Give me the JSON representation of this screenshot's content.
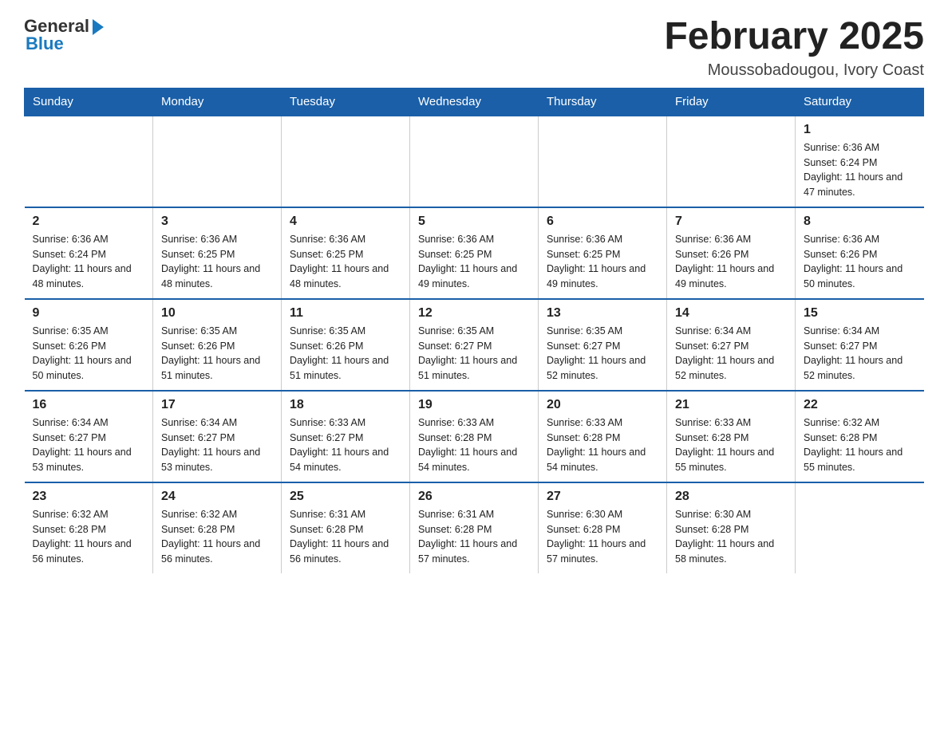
{
  "logo": {
    "general": "General",
    "blue": "Blue"
  },
  "title": "February 2025",
  "location": "Moussobadougou, Ivory Coast",
  "days_of_week": [
    "Sunday",
    "Monday",
    "Tuesday",
    "Wednesday",
    "Thursday",
    "Friday",
    "Saturday"
  ],
  "weeks": [
    [
      {
        "day": "",
        "info": ""
      },
      {
        "day": "",
        "info": ""
      },
      {
        "day": "",
        "info": ""
      },
      {
        "day": "",
        "info": ""
      },
      {
        "day": "",
        "info": ""
      },
      {
        "day": "",
        "info": ""
      },
      {
        "day": "1",
        "info": "Sunrise: 6:36 AM\nSunset: 6:24 PM\nDaylight: 11 hours and 47 minutes."
      }
    ],
    [
      {
        "day": "2",
        "info": "Sunrise: 6:36 AM\nSunset: 6:24 PM\nDaylight: 11 hours and 48 minutes."
      },
      {
        "day": "3",
        "info": "Sunrise: 6:36 AM\nSunset: 6:25 PM\nDaylight: 11 hours and 48 minutes."
      },
      {
        "day": "4",
        "info": "Sunrise: 6:36 AM\nSunset: 6:25 PM\nDaylight: 11 hours and 48 minutes."
      },
      {
        "day": "5",
        "info": "Sunrise: 6:36 AM\nSunset: 6:25 PM\nDaylight: 11 hours and 49 minutes."
      },
      {
        "day": "6",
        "info": "Sunrise: 6:36 AM\nSunset: 6:25 PM\nDaylight: 11 hours and 49 minutes."
      },
      {
        "day": "7",
        "info": "Sunrise: 6:36 AM\nSunset: 6:26 PM\nDaylight: 11 hours and 49 minutes."
      },
      {
        "day": "8",
        "info": "Sunrise: 6:36 AM\nSunset: 6:26 PM\nDaylight: 11 hours and 50 minutes."
      }
    ],
    [
      {
        "day": "9",
        "info": "Sunrise: 6:35 AM\nSunset: 6:26 PM\nDaylight: 11 hours and 50 minutes."
      },
      {
        "day": "10",
        "info": "Sunrise: 6:35 AM\nSunset: 6:26 PM\nDaylight: 11 hours and 51 minutes."
      },
      {
        "day": "11",
        "info": "Sunrise: 6:35 AM\nSunset: 6:26 PM\nDaylight: 11 hours and 51 minutes."
      },
      {
        "day": "12",
        "info": "Sunrise: 6:35 AM\nSunset: 6:27 PM\nDaylight: 11 hours and 51 minutes."
      },
      {
        "day": "13",
        "info": "Sunrise: 6:35 AM\nSunset: 6:27 PM\nDaylight: 11 hours and 52 minutes."
      },
      {
        "day": "14",
        "info": "Sunrise: 6:34 AM\nSunset: 6:27 PM\nDaylight: 11 hours and 52 minutes."
      },
      {
        "day": "15",
        "info": "Sunrise: 6:34 AM\nSunset: 6:27 PM\nDaylight: 11 hours and 52 minutes."
      }
    ],
    [
      {
        "day": "16",
        "info": "Sunrise: 6:34 AM\nSunset: 6:27 PM\nDaylight: 11 hours and 53 minutes."
      },
      {
        "day": "17",
        "info": "Sunrise: 6:34 AM\nSunset: 6:27 PM\nDaylight: 11 hours and 53 minutes."
      },
      {
        "day": "18",
        "info": "Sunrise: 6:33 AM\nSunset: 6:27 PM\nDaylight: 11 hours and 54 minutes."
      },
      {
        "day": "19",
        "info": "Sunrise: 6:33 AM\nSunset: 6:28 PM\nDaylight: 11 hours and 54 minutes."
      },
      {
        "day": "20",
        "info": "Sunrise: 6:33 AM\nSunset: 6:28 PM\nDaylight: 11 hours and 54 minutes."
      },
      {
        "day": "21",
        "info": "Sunrise: 6:33 AM\nSunset: 6:28 PM\nDaylight: 11 hours and 55 minutes."
      },
      {
        "day": "22",
        "info": "Sunrise: 6:32 AM\nSunset: 6:28 PM\nDaylight: 11 hours and 55 minutes."
      }
    ],
    [
      {
        "day": "23",
        "info": "Sunrise: 6:32 AM\nSunset: 6:28 PM\nDaylight: 11 hours and 56 minutes."
      },
      {
        "day": "24",
        "info": "Sunrise: 6:32 AM\nSunset: 6:28 PM\nDaylight: 11 hours and 56 minutes."
      },
      {
        "day": "25",
        "info": "Sunrise: 6:31 AM\nSunset: 6:28 PM\nDaylight: 11 hours and 56 minutes."
      },
      {
        "day": "26",
        "info": "Sunrise: 6:31 AM\nSunset: 6:28 PM\nDaylight: 11 hours and 57 minutes."
      },
      {
        "day": "27",
        "info": "Sunrise: 6:30 AM\nSunset: 6:28 PM\nDaylight: 11 hours and 57 minutes."
      },
      {
        "day": "28",
        "info": "Sunrise: 6:30 AM\nSunset: 6:28 PM\nDaylight: 11 hours and 58 minutes."
      },
      {
        "day": "",
        "info": ""
      }
    ]
  ]
}
